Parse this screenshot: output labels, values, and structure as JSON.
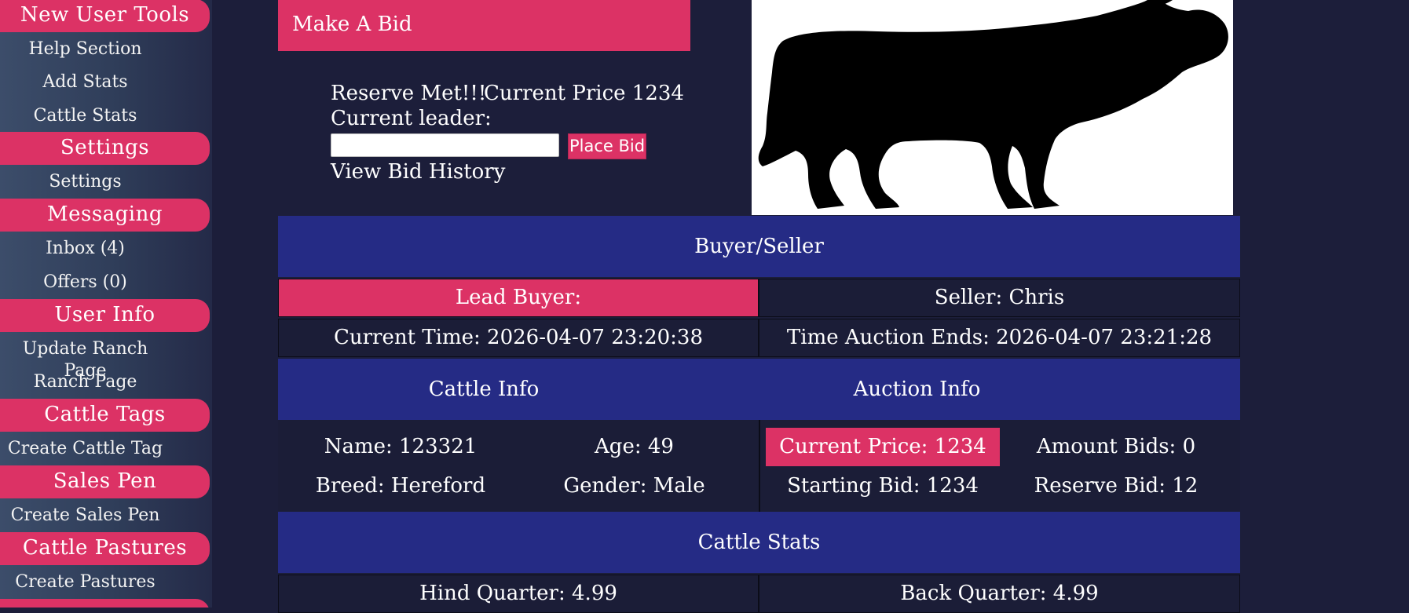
{
  "sidebar": {
    "sections": [
      {
        "heading": "New User Tools",
        "items": [
          "Help Section",
          "Add Stats",
          "Cattle Stats"
        ]
      },
      {
        "heading": "Settings",
        "items": [
          "Settings"
        ]
      },
      {
        "heading": "Messaging",
        "items": [
          "Inbox (4)",
          "Offers (0)"
        ]
      },
      {
        "heading": "User Info",
        "items": [
          "Update Ranch Page",
          "Ranch Page"
        ]
      },
      {
        "heading": "Cattle Tags",
        "items": [
          "Create Cattle Tag"
        ]
      },
      {
        "heading": "Sales Pen",
        "items": [
          "Create Sales Pen"
        ]
      },
      {
        "heading": "Cattle Pastures",
        "items": [
          "Create Pastures"
        ]
      }
    ]
  },
  "bid": {
    "title": "Make A Bid",
    "reserve": "Reserve Met!!!",
    "current_price": "Current Price 1234",
    "leader": "Current leader:",
    "input_value": "",
    "place_bid": "Place Bid",
    "history": "View Bid History"
  },
  "image": {
    "icon": "cow-silhouette"
  },
  "table": {
    "buyer_seller_heading": "Buyer/Seller",
    "lead_buyer": "Lead Buyer:",
    "seller": "Seller: Chris",
    "current_time": "Current Time: 2026-04-07 23:20:38",
    "auction_ends": "Time Auction Ends: 2026-04-07 23:21:28",
    "cattle_info_heading": "Cattle Info",
    "auction_info_heading": "Auction Info",
    "name": "Name: 123321",
    "age": "Age: 49",
    "breed": "Breed: Hereford",
    "gender": "Gender: Male",
    "info_current_price": "Current Price: 1234",
    "amount_bids": "Amount Bids: 0",
    "starting_bid": "Starting Bid: 1234",
    "reserve_bid": "Reserve Bid: 12",
    "cattle_stats_heading": "Cattle Stats",
    "hind_quarter": "Hind Quarter: 4.99",
    "back_quarter": "Back Quarter: 4.99"
  },
  "colors": {
    "accent": "#dc3265",
    "band": "#252b85",
    "background": "#1c1e3a"
  }
}
